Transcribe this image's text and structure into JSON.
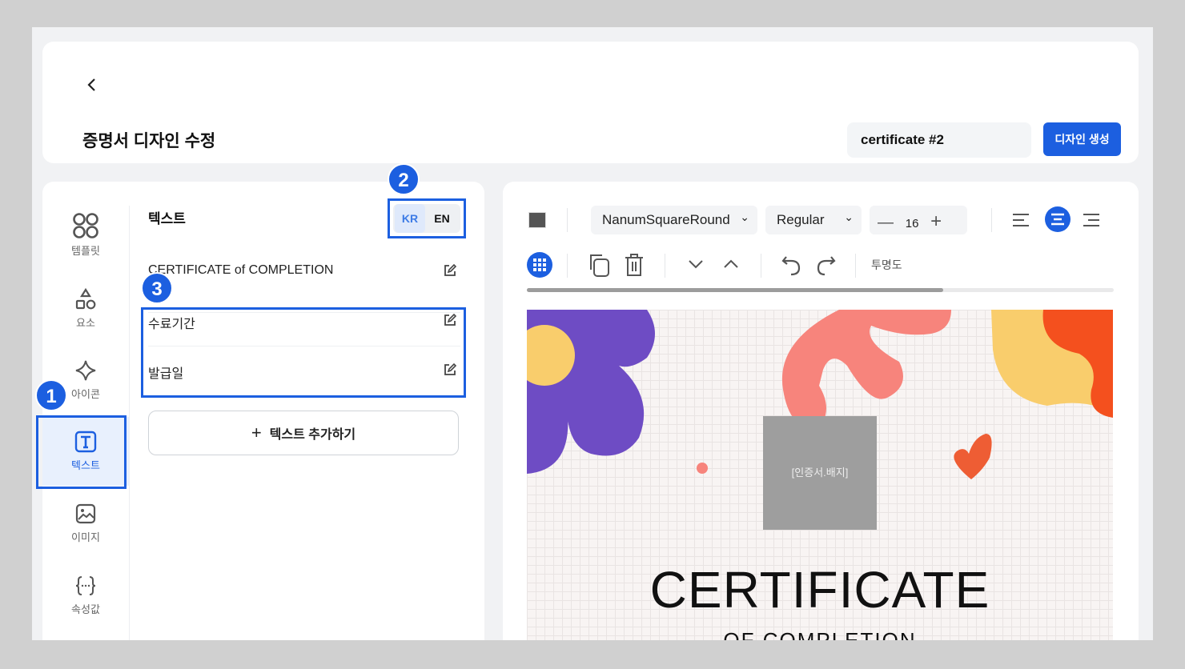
{
  "header": {
    "back_icon": "chevron-left-icon",
    "title": "증명서 디자인 수정",
    "document_name": "certificate #2",
    "create_button": "디자인 생성"
  },
  "sidebar": {
    "items": [
      {
        "label": "템플릿",
        "icon": "template-grid-icon"
      },
      {
        "label": "요소",
        "icon": "shapes-icon"
      },
      {
        "label": "아이콘",
        "icon": "sparkle-icon"
      },
      {
        "label": "텍스트",
        "icon": "text-icon",
        "active": true
      },
      {
        "label": "이미지",
        "icon": "image-icon"
      },
      {
        "label": "속성값",
        "icon": "braces-icon"
      }
    ]
  },
  "text_panel": {
    "title": "텍스트",
    "languages": [
      "KR",
      "EN"
    ],
    "active_language": "KR",
    "items": [
      "CERTIFICATE of COMPLETION",
      "수료기간",
      "발급일"
    ],
    "add_button": "텍스트 추가하기"
  },
  "toolbar": {
    "font_family": "NanumSquareRound",
    "font_weight": "Regular",
    "font_size": "16",
    "opacity_label": "투명도",
    "text_align": "center",
    "scroll_progress": 0.71
  },
  "canvas": {
    "badge_placeholder": "[인증서.배지]",
    "heading": "CERTIFICATE",
    "subheading": "OF COMPLETION"
  },
  "annotations": [
    "1",
    "2",
    "3"
  ],
  "colors": {
    "accent": "#1c5fe0",
    "purple": "#6e4cc4",
    "coral": "#f7847c",
    "yellow": "#f9cd6c",
    "orange": "#f4501e"
  }
}
